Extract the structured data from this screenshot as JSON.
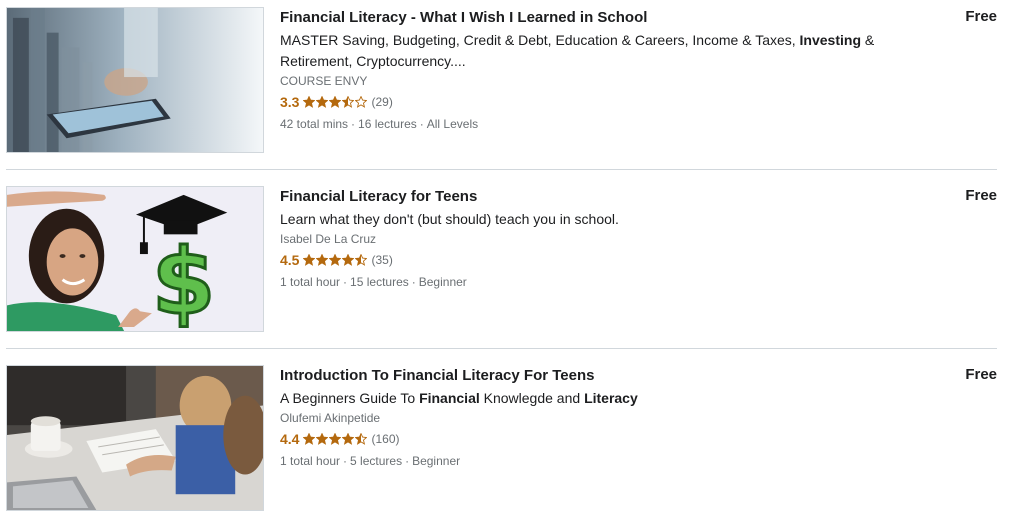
{
  "colors": {
    "rating": "#b4690e",
    "muted": "#6a6f73",
    "text": "#1c1d1f",
    "divider": "#d1d7dc"
  },
  "courses": [
    {
      "title": "Financial Literacy - What I Wish I Learned in School",
      "headline_parts": [
        {
          "text": "MASTER Saving, Budgeting, Credit & Debt, Education & Careers, Income & Taxes, ",
          "bold": false
        },
        {
          "text": "Investing",
          "bold": true
        },
        {
          "text": " & Retirement, Cryptocurrency....",
          "bold": false
        }
      ],
      "instructor": "COURSE ENVY",
      "rating": "3.3",
      "rating_value": 3.3,
      "review_count": "(29)",
      "total_length": "42 total mins",
      "lectures": "16 lectures",
      "level": "All Levels",
      "price": "Free",
      "thumbnail_icon": "city-tablet-thumbnail"
    },
    {
      "title": "Financial Literacy for Teens",
      "headline_parts": [
        {
          "text": "Learn what they don't (but should) teach you in school.",
          "bold": false
        }
      ],
      "instructor": "Isabel De La Cruz",
      "rating": "4.5",
      "rating_value": 4.5,
      "review_count": "(35)",
      "total_length": "1 total hour",
      "lectures": "15 lectures",
      "level": "Beginner",
      "price": "Free",
      "thumbnail_icon": "graduate-dollar-thumbnail"
    },
    {
      "title": "Introduction To Financial Literacy For Teens",
      "headline_parts": [
        {
          "text": "A Beginners Guide To ",
          "bold": false
        },
        {
          "text": "Financial",
          "bold": true
        },
        {
          "text": " Knowlegde and ",
          "bold": false
        },
        {
          "text": "Literacy",
          "bold": true
        }
      ],
      "instructor": "Olufemi Akinpetide",
      "rating": "4.4",
      "rating_value": 4.4,
      "review_count": "(160)",
      "total_length": "1 total hour",
      "lectures": "5 lectures",
      "level": "Beginner",
      "price": "Free",
      "thumbnail_icon": "desk-study-thumbnail"
    }
  ],
  "separator": "·"
}
